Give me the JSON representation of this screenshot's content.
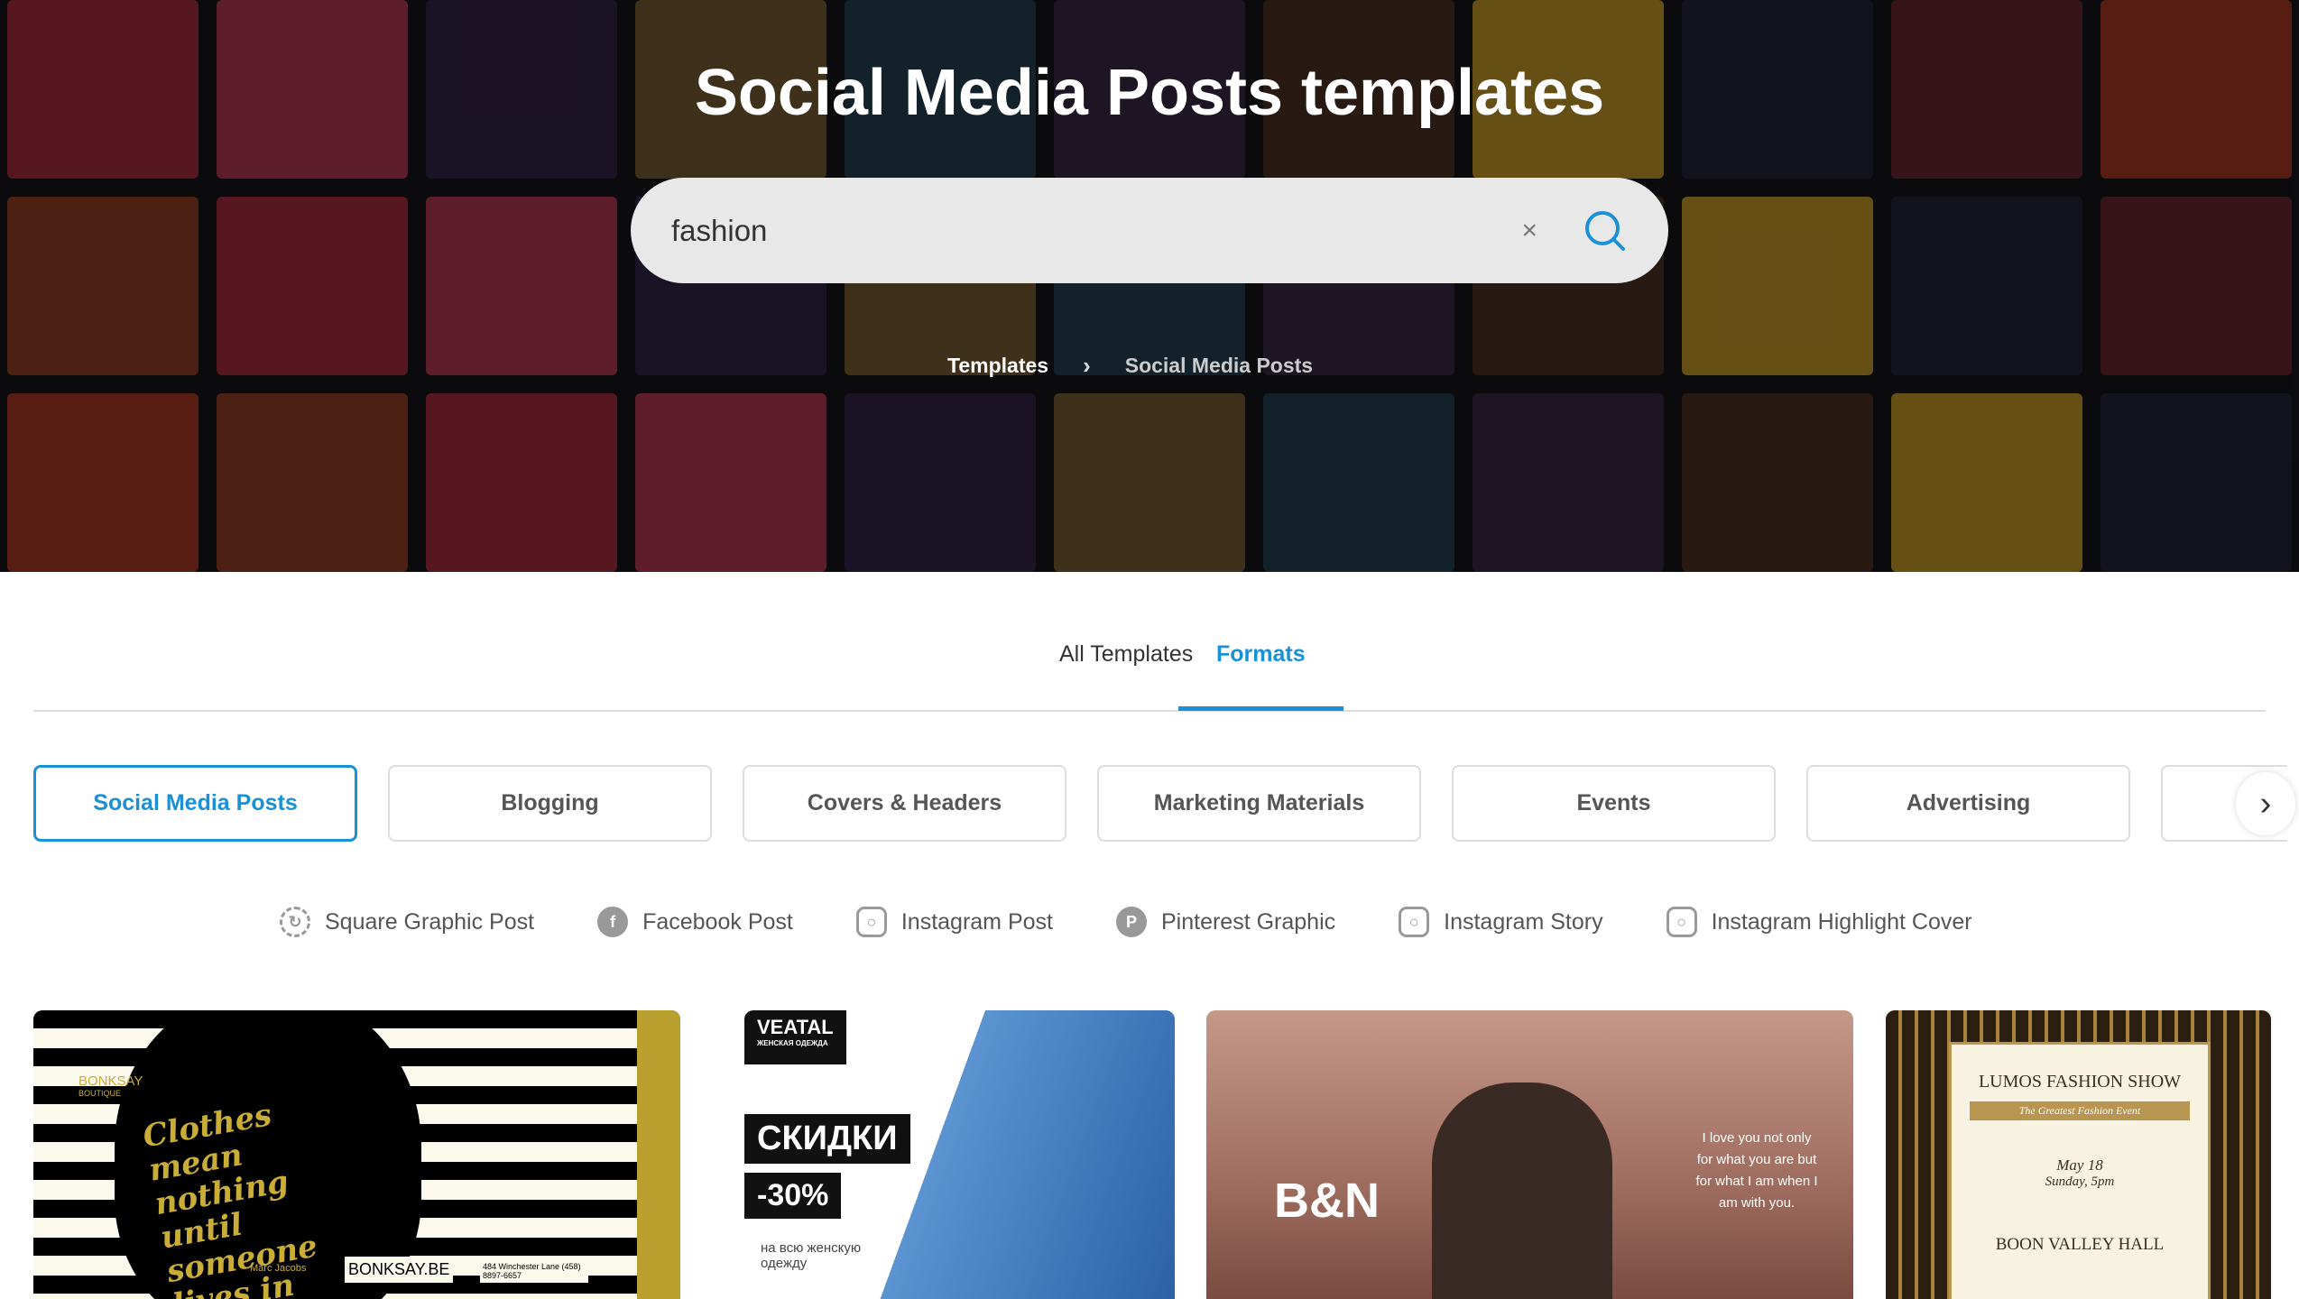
{
  "hero": {
    "title": "Social Media Posts templates",
    "search": {
      "value": "fashion",
      "clear_icon": "close-icon",
      "search_icon": "search-icon",
      "accent": "#1a90d6"
    },
    "breadcrumb": [
      {
        "label": "Templates"
      },
      {
        "label": "Social Media Posts"
      }
    ]
  },
  "tabs": [
    {
      "label": "All Templates",
      "active": false
    },
    {
      "label": "Formats",
      "active": true
    }
  ],
  "categories": [
    {
      "label": "Social Media Posts",
      "active": true
    },
    {
      "label": "Blogging"
    },
    {
      "label": "Covers & Headers"
    },
    {
      "label": "Marketing Materials"
    },
    {
      "label": "Events"
    },
    {
      "label": "Advertising"
    }
  ],
  "formats": [
    {
      "label": "Square Graphic Post",
      "icon": "square-post-icon"
    },
    {
      "label": "Facebook Post",
      "icon": "facebook-icon"
    },
    {
      "label": "Instagram Post",
      "icon": "instagram-icon"
    },
    {
      "label": "Pinterest Graphic",
      "icon": "pinterest-icon"
    },
    {
      "label": "Instagram Story",
      "icon": "instagram-icon"
    },
    {
      "label": "Instagram Highlight Cover",
      "icon": "instagram-icon"
    }
  ],
  "cards": [
    {
      "brand": "BONKSAY",
      "brand_sub": "BOUTIQUE",
      "quote": "Clothes mean nothing until someone lives in them",
      "author": "Marc Jacobs",
      "site": "BONKSAY.BE",
      "address": "484 Winchester Lane (458) 8897-6657"
    },
    {
      "brand": "VEATAL",
      "brand_sub": "ЖЕНСКАЯ ОДЕЖДА",
      "headline": "СКИДКИ",
      "discount": "-30%",
      "sub": "на всю женскую одежду"
    },
    {
      "brand": "B&N",
      "quote": "I love you not only for what you are but for what I am when I am with you."
    },
    {
      "title": "LUMOS FASHION SHOW",
      "subtitle": "The Greatest Fashion Event",
      "date": "May 18",
      "time": "Sunday, 5pm",
      "venue": "BOON VALLEY HALL"
    }
  ]
}
